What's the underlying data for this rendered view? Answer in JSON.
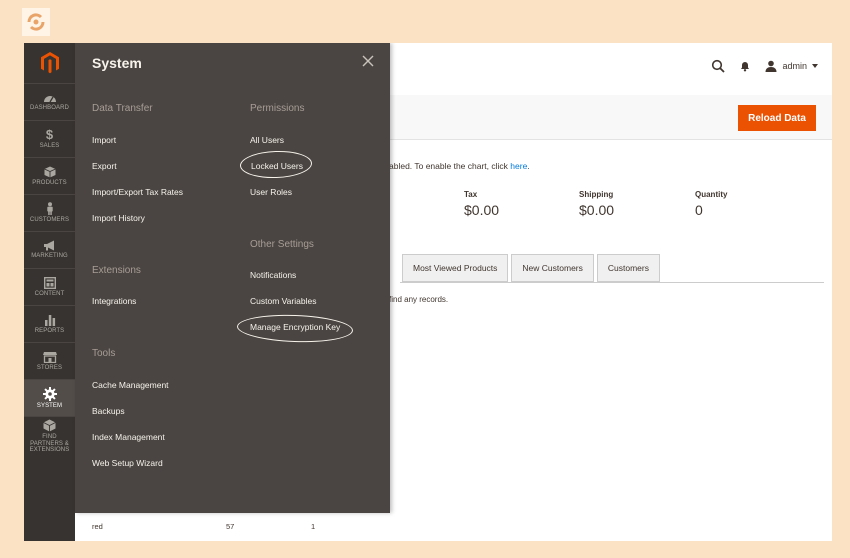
{
  "nav": {
    "items": [
      {
        "label": "DASHBOARD",
        "icon": "dashboard-icon"
      },
      {
        "label": "SALES",
        "icon": "dollar-icon"
      },
      {
        "label": "PRODUCTS",
        "icon": "cube-icon"
      },
      {
        "label": "CUSTOMERS",
        "icon": "person-icon"
      },
      {
        "label": "MARKETING",
        "icon": "megaphone-icon"
      },
      {
        "label": "CONTENT",
        "icon": "layout-icon"
      },
      {
        "label": "REPORTS",
        "icon": "bar-chart-icon"
      },
      {
        "label": "STORES",
        "icon": "storefront-icon"
      },
      {
        "label": "SYSTEM",
        "icon": "gear-icon"
      },
      {
        "label": "FIND PARTNERS & EXTENSIONS",
        "icon": "box-icon"
      }
    ],
    "active": "SYSTEM"
  },
  "header": {
    "user": "admin"
  },
  "dashboard": {
    "reload_label": "Reload Data",
    "chart_note": "abled. To enable the chart, click ",
    "chart_link": "here",
    "chart_note_end": ".",
    "metrics": [
      {
        "label": "Tax",
        "value": "$0.00"
      },
      {
        "label": "Shipping",
        "value": "$0.00"
      },
      {
        "label": "Quantity",
        "value": "0"
      }
    ],
    "tabs": [
      "Most Viewed Products",
      "New Customers",
      "Customers"
    ],
    "no_records": "find any records.",
    "bottom_row": [
      "red",
      "57",
      "1"
    ]
  },
  "system_menu": {
    "title": "System",
    "sections": {
      "data_transfer": {
        "title": "Data Transfer",
        "items": [
          "Import",
          "Export",
          "Import/Export Tax Rates",
          "Import History"
        ]
      },
      "extensions": {
        "title": "Extensions",
        "items": [
          "Integrations"
        ]
      },
      "tools": {
        "title": "Tools",
        "items": [
          "Cache Management",
          "Backups",
          "Index Management",
          "Web Setup Wizard"
        ]
      },
      "permissions": {
        "title": "Permissions",
        "items": [
          "All Users",
          "Locked Users",
          "User Roles"
        ]
      },
      "other_settings": {
        "title": "Other Settings",
        "items": [
          "Notifications",
          "Custom Variables",
          "Manage Encryption Key"
        ]
      }
    }
  },
  "colors": {
    "accent": "#eb5202",
    "nav_bg": "#373330",
    "menu_bg": "#4a4542",
    "link": "#007bdb",
    "page_bg": "#fbe2c4"
  }
}
